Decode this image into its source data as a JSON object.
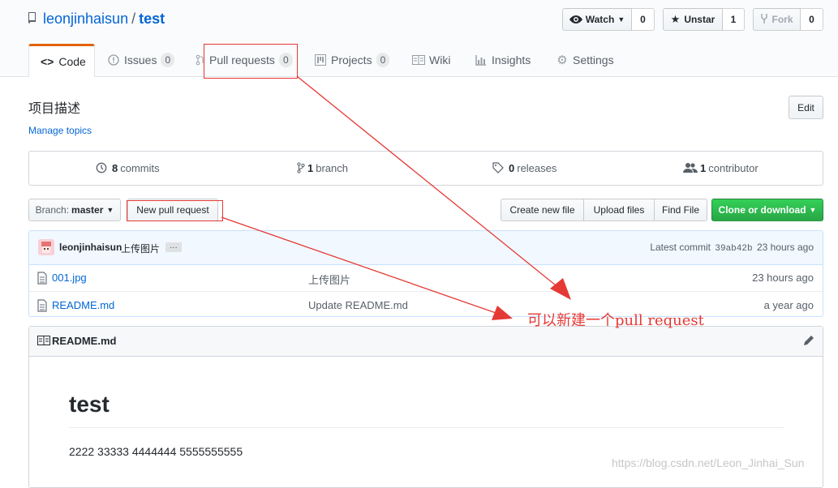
{
  "repo": {
    "owner": "leonjinhaisun",
    "separator": "/",
    "name": "test"
  },
  "actions": {
    "watch_label": "Watch",
    "watch_count": "0",
    "unstar_label": "Unstar",
    "star_count": "1",
    "fork_label": "Fork",
    "fork_count": "0"
  },
  "tabs": [
    {
      "label": "Code"
    },
    {
      "label": "Issues",
      "count": "0"
    },
    {
      "label": "Pull requests",
      "count": "0"
    },
    {
      "label": "Projects",
      "count": "0"
    },
    {
      "label": "Wiki"
    },
    {
      "label": "Insights"
    },
    {
      "label": "Settings"
    }
  ],
  "description": "项目描述",
  "edit_label": "Edit",
  "manage_topics": "Manage topics",
  "summary": {
    "commits_num": "8",
    "commits_label": "commits",
    "branch_num": "1",
    "branch_label": "branch",
    "releases_num": "0",
    "releases_label": "releases",
    "contributor_num": "1",
    "contributor_label": "contributor"
  },
  "toolbar": {
    "branch_prefix": "Branch:",
    "branch_name": "master",
    "new_pr": "New pull request",
    "create_file": "Create new file",
    "upload_files": "Upload files",
    "find_file": "Find File",
    "clone": "Clone or download"
  },
  "commit": {
    "author": "leonjinhaisun",
    "message": "上传图片",
    "ellipsis": "…",
    "latest_prefix": "Latest commit",
    "sha": "39ab42b",
    "age": "23 hours ago"
  },
  "files": [
    {
      "name": "001.jpg",
      "message": "上传图片",
      "age": "23 hours ago"
    },
    {
      "name": "README.md",
      "message": "Update README.md",
      "age": "a year ago"
    }
  ],
  "readme": {
    "filename": "README.md",
    "heading": "test",
    "body": "2222 33333 4444444 5555555555"
  },
  "annotation": {
    "text": "可以新建一个pull request",
    "color": "#e53935"
  },
  "watermark": "https://blog.csdn.net/Leon_Jinhai_Sun",
  "colors": {
    "accent": "#0366d6",
    "tab_active": "#e36209",
    "clone_green": "#2cbe4e"
  }
}
